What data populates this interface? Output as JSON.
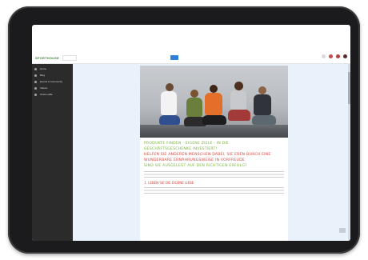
{
  "header": {
    "logo_text": "SPORTHOUSE",
    "search_placeholder": "",
    "user_text": "",
    "accent_color": "#2f7fd6"
  },
  "sidebar": {
    "items": [
      {
        "label": "Home",
        "icon": "home-icon"
      },
      {
        "label": "Blog",
        "icon": "document-icon"
      },
      {
        "label": "Events & Community",
        "icon": "calendar-icon"
      },
      {
        "label": "Videos",
        "icon": "video-icon"
      },
      {
        "label": "Online-Hilfe",
        "icon": "help-icon"
      }
    ]
  },
  "article": {
    "headline_lines": [
      {
        "text": "PRODUKTE FINDEN - EIGENE ZIELE - IN DIE",
        "color": "green"
      },
      {
        "text": "GESCHÄFTSGESCHENKE INVESTIERT!",
        "color": "green"
      },
      {
        "text": "HELFEN SIE ANDEREN MENSCHEN DABEI, SIE EBEN DURCH EINE",
        "color": "red"
      },
      {
        "text": "WUNDERBARE ERNÄHRUNGSWEISE IN VORFREUDE",
        "color": "red"
      },
      {
        "text": "SIND SIE AUSGELEGT AUF DEN RICHTIGEN ERFOLG?",
        "color": "green"
      }
    ],
    "paragraph": "",
    "subheading": "1. LEBEN SIE DIE EIGENE LIEBE",
    "paragraph2": ""
  }
}
